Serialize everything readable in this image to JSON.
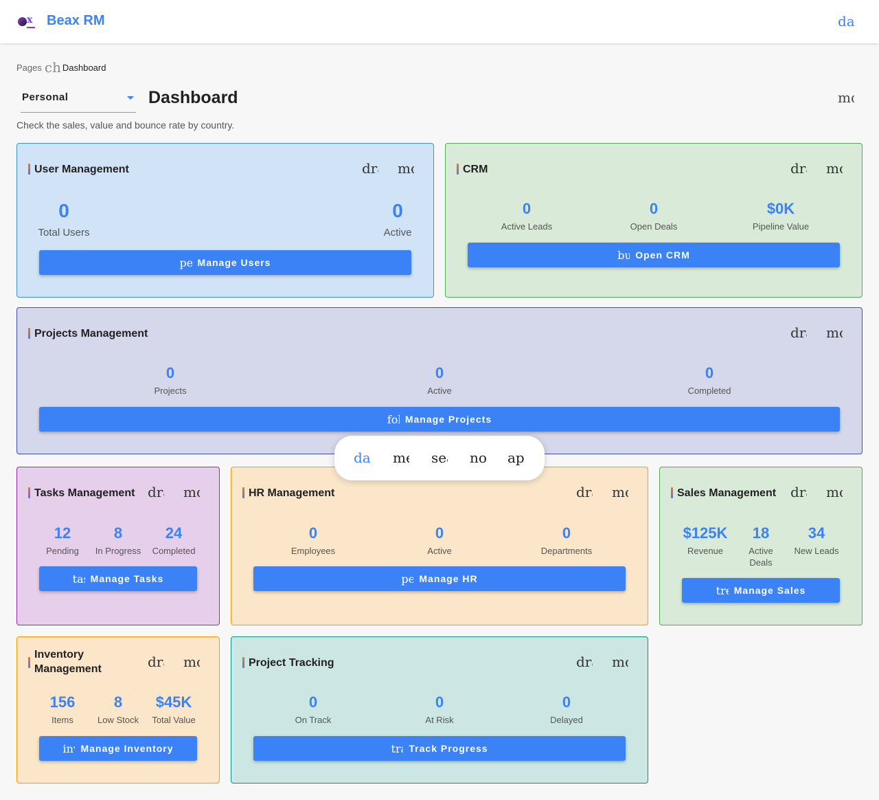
{
  "app": {
    "title": "Beax RM",
    "logo_letter": "x",
    "top_icon": "dashboard"
  },
  "breadcrumb": {
    "pages": "Pages",
    "separator_icon": "chevron_right",
    "current": "Dashboard"
  },
  "header": {
    "selector_value": "Personal",
    "title": "Dashboard",
    "more_icon": "more_vert",
    "subtitle": "Check the sales, value and bounce rate by country."
  },
  "icons": {
    "drag": "drag_indicator",
    "more": "more_vert"
  },
  "cards": {
    "users": {
      "title": "User Management",
      "stats": [
        {
          "value": "0",
          "label": "Total Users"
        },
        {
          "value": "0",
          "label": "Active"
        }
      ],
      "button_icon": "people",
      "button": "Manage Users"
    },
    "crm": {
      "title": "CRM",
      "stats": [
        {
          "value": "0",
          "label": "Active Leads"
        },
        {
          "value": "0",
          "label": "Open Deals"
        },
        {
          "value": "$0K",
          "label": "Pipeline Value"
        }
      ],
      "button_icon": "business",
      "button": "Open CRM"
    },
    "projects": {
      "title": "Projects Management",
      "stats": [
        {
          "value": "0",
          "label": "Projects"
        },
        {
          "value": "0",
          "label": "Active"
        },
        {
          "value": "0",
          "label": "Completed"
        }
      ],
      "button_icon": "folder",
      "button": "Manage Projects"
    },
    "tasks": {
      "title": "Tasks Management",
      "stats": [
        {
          "value": "12",
          "label": "Pending"
        },
        {
          "value": "8",
          "label": "In Progress"
        },
        {
          "value": "24",
          "label": "Completed"
        }
      ],
      "button_icon": "task",
      "button": "Manage Tasks"
    },
    "hr": {
      "title": "HR Management",
      "stats": [
        {
          "value": "0",
          "label": "Employees"
        },
        {
          "value": "0",
          "label": "Active"
        },
        {
          "value": "0",
          "label": "Departments"
        }
      ],
      "button_icon": "people",
      "button": "Manage HR"
    },
    "sales": {
      "title": "Sales Management",
      "stats": [
        {
          "value": "$125K",
          "label": "Revenue"
        },
        {
          "value": "18",
          "label": "Active Deals"
        },
        {
          "value": "34",
          "label": "New Leads"
        }
      ],
      "button_icon": "trending_up",
      "button": "Manage Sales"
    },
    "inventory": {
      "title": "Inventory Management",
      "stats": [
        {
          "value": "156",
          "label": "Items"
        },
        {
          "value": "8",
          "label": "Low Stock"
        },
        {
          "value": "$45K",
          "label": "Total Value"
        }
      ],
      "button_icon": "inventory",
      "button": "Manage Inventory"
    },
    "tracking": {
      "title": "Project Tracking",
      "stats": [
        {
          "value": "0",
          "label": "On Track"
        },
        {
          "value": "0",
          "label": "At Risk"
        },
        {
          "value": "0",
          "label": "Delayed"
        }
      ],
      "button_icon": "track_changes",
      "button": "Track Progress"
    }
  },
  "bottom_nav": [
    {
      "icon": "dashboard",
      "active": true
    },
    {
      "icon": "menu",
      "active": false
    },
    {
      "icon": "search",
      "active": false
    },
    {
      "icon": "notifications",
      "active": false
    },
    {
      "icon": "apps",
      "active": false
    }
  ],
  "colors": {
    "accent": "#3b82f6",
    "blue_card": "#d0e3f7",
    "green_card": "#d9ead9",
    "indigo_card": "#d5d7ea",
    "purple_card": "#e6cfea",
    "orange_card": "#fbe6c9",
    "teal_card": "#cbe6e3"
  }
}
